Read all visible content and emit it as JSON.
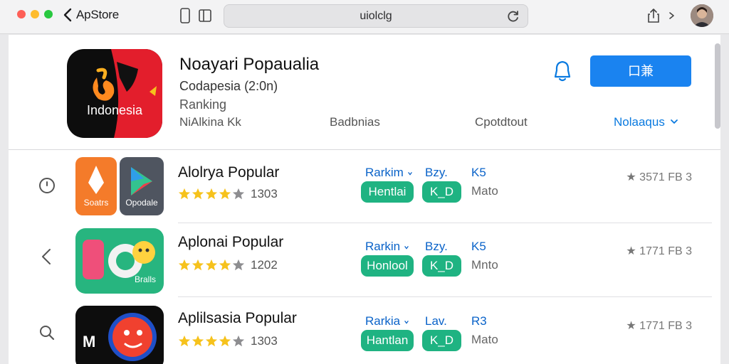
{
  "toolbar": {
    "back_label": "ApStore",
    "address": "uiolclg",
    "icons": [
      "back-chevron-icon",
      "phone-icon",
      "sidebar-icon",
      "reload-icon",
      "share-icon",
      "forward-chevron-icon"
    ]
  },
  "header": {
    "icon_text": "Indonesia",
    "title": "Noayari Popaualia",
    "subtitle": "Codapesia  (2:0n)",
    "ranking": "Ranking",
    "links": [
      "NiAlkina  Kk",
      "Badbnias",
      "Cpotdtout",
      "Nolaaqus"
    ],
    "get_button": "口兼"
  },
  "apps": [
    {
      "name": "Alolrya Popular",
      "stars": 4,
      "count": "1303",
      "label1": "Rarkim",
      "label2": "Bzy.",
      "label3": "K5",
      "pill1": "Hentlai",
      "pill2": "K_D",
      "gray": "Mato",
      "right": "★ 3571 FB  3",
      "icon_left_text": "Soatrs",
      "icon_right_text": "Opodale"
    },
    {
      "name": "Aplonai Popular",
      "stars": 4,
      "count": "1202",
      "label1": "Rarkin",
      "label2": "Bzy.",
      "label3": "K5",
      "pill1": "Honlool",
      "pill2": "K_D",
      "gray": "Mnto",
      "right": "★ 1771 FB  3",
      "icon_text": "Bralls"
    },
    {
      "name": "Aplilsasia Popular",
      "stars": 4,
      "count": "1303",
      "label1": "Rarkia",
      "label2": "Lav.",
      "label3": "R3",
      "pill1": "Hantlan",
      "pill2": "K_D",
      "gray": "Mato",
      "right": "★ 1771 FB  3",
      "icon_text": "M"
    }
  ],
  "colors": {
    "accent_blue": "#1a83f0",
    "pill_green": "#1fb382",
    "star_yellow": "#f6c21c"
  }
}
